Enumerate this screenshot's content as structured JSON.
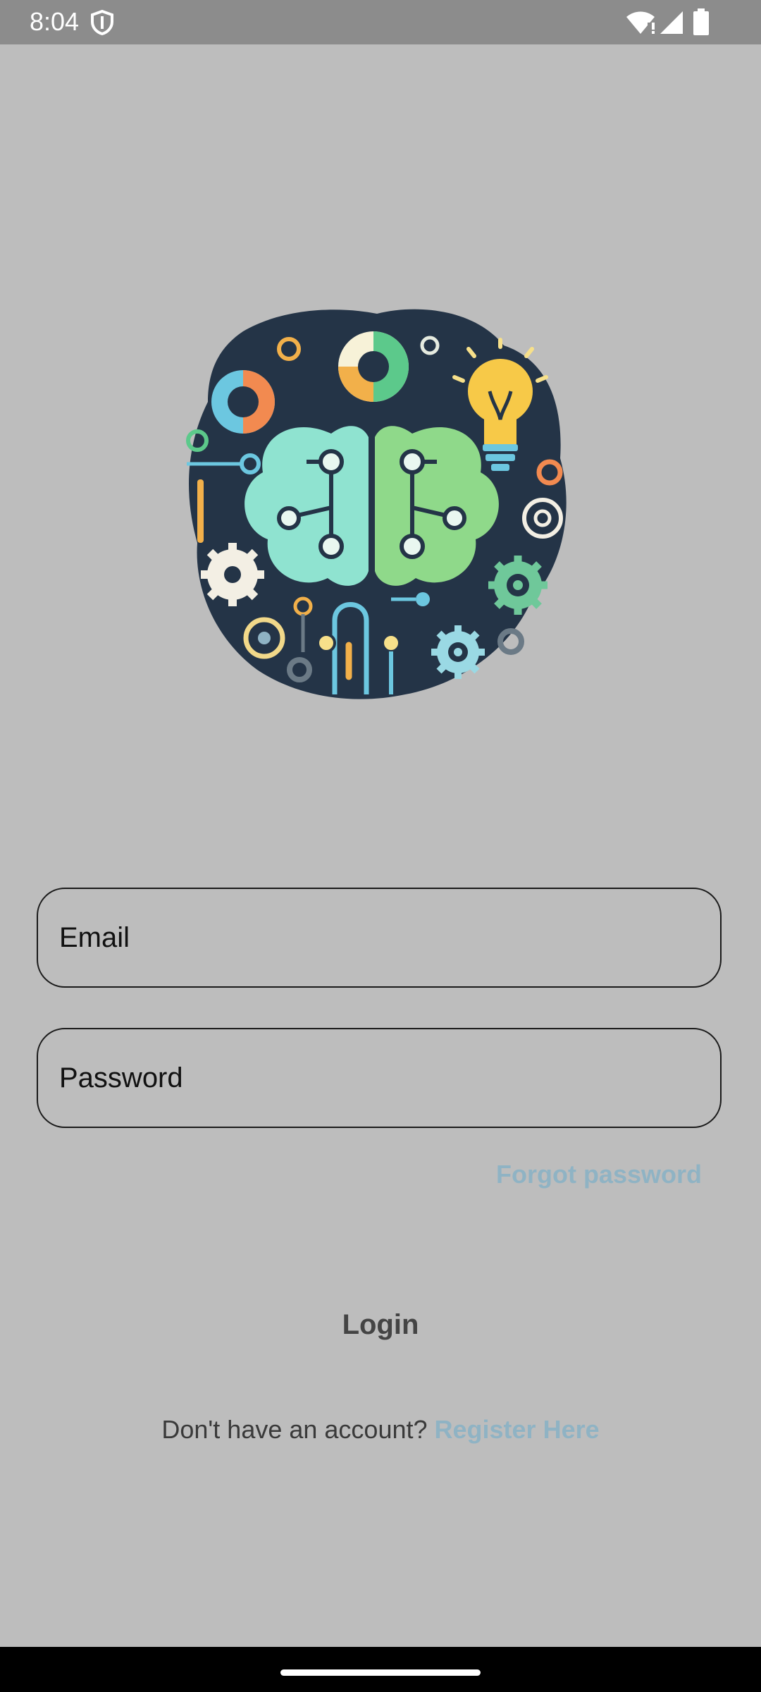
{
  "status_bar": {
    "time": "8:04",
    "icons": [
      "shield-icon",
      "wifi-icon",
      "signal-icon",
      "battery-icon"
    ]
  },
  "logo": {
    "icon": "brain-circuit-logo"
  },
  "form": {
    "email_placeholder": "Email",
    "password_placeholder": "Password",
    "forgot_label": "Forgot password",
    "login_label": "Login"
  },
  "register": {
    "prompt": "Don't have an account? ",
    "link_label": "Register Here"
  },
  "colors": {
    "background": "#bdbdbd",
    "status_bar": "#8c8c8c",
    "link": "#8fb3c4",
    "nav_bar": "#000000"
  }
}
